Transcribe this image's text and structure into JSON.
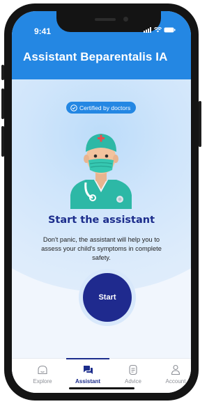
{
  "status_bar": {
    "time": "9:41"
  },
  "header": {
    "title": "Assistant Beparentalis IA"
  },
  "hero": {
    "badge": "Certified by doctors",
    "title": "Start the assistant",
    "description": "Don't panic, the assistant will help you to assess your child's symptoms in complete safety.",
    "start_label": "Start"
  },
  "tabs": [
    {
      "label": "Explore",
      "icon": "home-icon",
      "active": false
    },
    {
      "label": "Assistant",
      "icon": "chat-icon",
      "active": true
    },
    {
      "label": "Advice",
      "icon": "document-icon",
      "active": false
    },
    {
      "label": "Account",
      "icon": "user-icon",
      "active": false
    }
  ],
  "colors": {
    "primary": "#2487e3",
    "navy": "#1c2d8c",
    "start": "#1f2a8e"
  }
}
